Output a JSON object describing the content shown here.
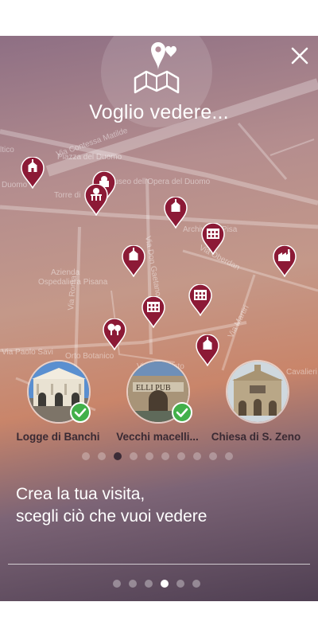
{
  "header": {
    "title": "Voglio vedere...",
    "hero_icon": "map-heart-icon",
    "close_icon": "close-icon"
  },
  "map": {
    "street_labels": [
      "Via Contessa Matilde",
      "Piazza del Duomo",
      "Torre di",
      "Museo dell'Opera del Duomo",
      "Archivio di Pisa",
      "Azienda",
      "Ospedaliera Pisana",
      "Via Don Gaetano",
      "Via Roma",
      "Orto Botanico",
      "Via Paolo Savi",
      "Via San Sisto",
      "Via Martiri",
      "Cavalieri",
      "Via Oberdan",
      "Duomo",
      "ltico"
    ],
    "pin_color": "#8c1a36"
  },
  "pois": [
    {
      "label": "Logge di Banchi",
      "selected": true
    },
    {
      "label": "Vecchi macelli...",
      "selected": true
    },
    {
      "label": "Chiesa di S. Zeno",
      "selected": false
    }
  ],
  "carousel_pages": 10,
  "carousel_active": 2,
  "caption": {
    "line1": "Crea la tua visita,",
    "line2": "scegli ciò che vuoi vedere"
  },
  "pager_pages": 6,
  "pager_active": 3,
  "colors": {
    "pin": "#8c1a36",
    "check": "#42b04a",
    "active_dot": "#3b2b36"
  }
}
